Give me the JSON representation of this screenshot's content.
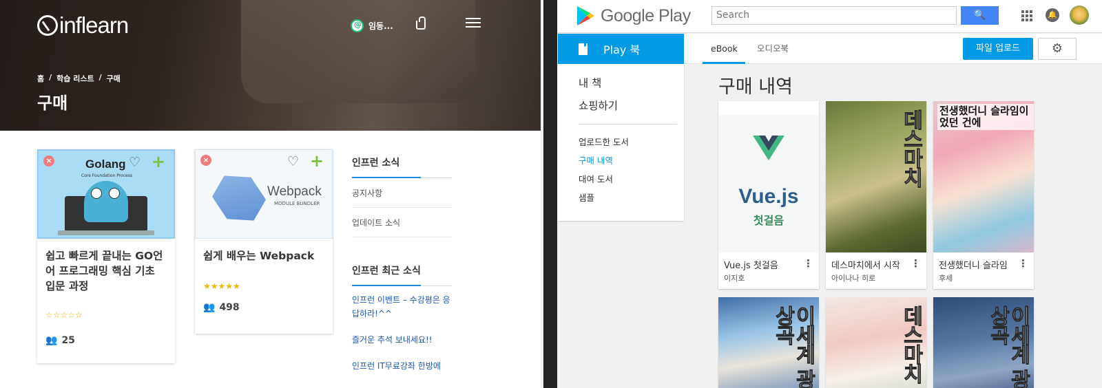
{
  "inflearn": {
    "logo_text": "inflearn",
    "user_name": "임동...",
    "breadcrumb": [
      "홈",
      "/",
      "학습 리스트",
      "/",
      "구매"
    ],
    "page_title": "구매",
    "courses": [
      {
        "thumb_word": "Golang",
        "thumb_sub": "Core Foundation Process",
        "title": "쉽고 빠르게 끝내는 GO언어 프로그래밍 핵심 기초 입문 과정",
        "rating_stars": "☆☆☆☆☆",
        "rating": 0,
        "students": "25"
      },
      {
        "thumb_word": "Webpack",
        "thumb_sub": "MODULE BUNDLER",
        "title": "쉽게 배우는 Webpack",
        "rating_stars": "★★★★★",
        "rating": 4.5,
        "students": "498"
      }
    ],
    "news_heading": "인프런 소식",
    "news_items": [
      "공지사항",
      "업데이트 소식"
    ],
    "recent_heading": "인프런 최근 소식",
    "recent_items": [
      "인프런 이벤트 – 수강평은 응답하라!^^",
      "즐거운 추석 보내세요!!",
      "인프런 IT무료강좌 한방에"
    ],
    "colors": {
      "link": "#1a58b8",
      "star": "#f5b301",
      "accent": "#1e88e5",
      "plus": "#7ac143"
    }
  },
  "google_play": {
    "brand": "Google Play",
    "search_placeholder": "Search",
    "sidebar_tab": "Play 북",
    "nav_main": [
      "내 책",
      "쇼핑하기"
    ],
    "nav_sub": [
      "업로드한 도서",
      "구매 내역",
      "대여 도서",
      "샘플"
    ],
    "active_nav": "구매 내역",
    "tabs": [
      "eBook",
      "오디오북"
    ],
    "active_tab": "eBook",
    "upload_button": "파일 업로드",
    "heading": "구매 내역",
    "books": [
      {
        "title": "Vue.js 첫걸음",
        "author": "이지호",
        "cover_title": "Vue.js",
        "cover_sub": "첫걸음"
      },
      {
        "title": "데스마치에서 시작",
        "author": "아이나나 히로",
        "cover_title": "데스마치"
      },
      {
        "title": "전생했더니 슬라임",
        "author": "후세",
        "cover_title": "전생했더니 슬라임이 었던 건에"
      },
      {
        "cover_title": "이세계 광상곡"
      },
      {
        "cover_title": "데스마치"
      },
      {
        "cover_title": "이세계 광상곡"
      }
    ],
    "colors": {
      "primary": "#039be5",
      "search": "#4285f4"
    }
  }
}
